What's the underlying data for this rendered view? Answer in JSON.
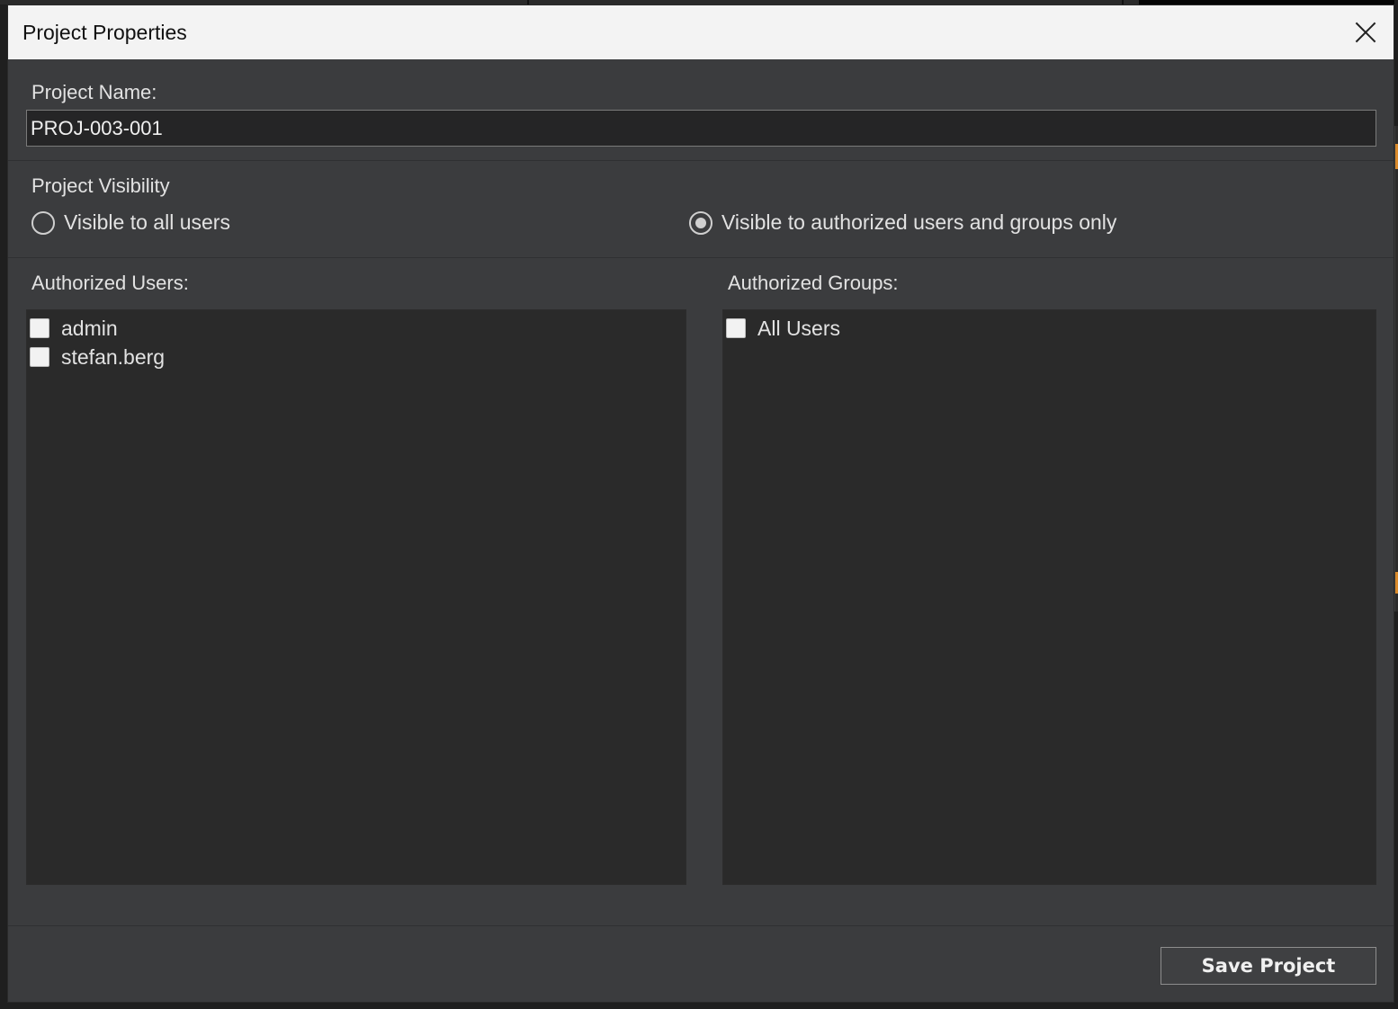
{
  "dialog": {
    "title": "Project Properties"
  },
  "project_name": {
    "label": "Project Name:",
    "value": "PROJ-003-001"
  },
  "visibility": {
    "label": "Project Visibility",
    "options": [
      {
        "label": "Visible to all users",
        "selected": false
      },
      {
        "label": "Visible to authorized users and groups only",
        "selected": true
      }
    ]
  },
  "authorized_users": {
    "label": "Authorized Users:",
    "items": [
      {
        "label": "admin",
        "checked": false
      },
      {
        "label": "stefan.berg",
        "checked": false
      }
    ]
  },
  "authorized_groups": {
    "label": "Authorized Groups:",
    "items": [
      {
        "label": "All Users",
        "checked": false
      }
    ]
  },
  "footer": {
    "save_label": "Save Project"
  },
  "colors": {
    "dialog_bg": "#3b3c3e",
    "list_bg": "#2a2a2a",
    "titlebar_bg": "#f3f3f3",
    "accent_orange": "#d98a2b"
  }
}
